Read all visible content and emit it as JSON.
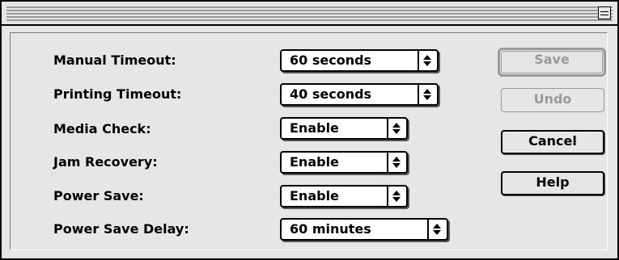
{
  "title_bar": {
    "collapse_icon": "window-collapse-icon"
  },
  "settings": [
    {
      "label": "Manual Timeout:",
      "value": "60 seconds"
    },
    {
      "label": "Printing Timeout:",
      "value": "40 seconds"
    },
    {
      "label": "Media Check:",
      "value": "Enable"
    },
    {
      "label": "Jam Recovery:",
      "value": "Enable"
    },
    {
      "label": "Power Save:",
      "value": "Enable"
    },
    {
      "label": "Power Save Delay:",
      "value": "60 minutes"
    }
  ],
  "buttons": {
    "save": "Save",
    "undo": "Undo",
    "cancel": "Cancel",
    "help": "Help"
  },
  "popup_arrow_icon": "up-down-arrows-icon"
}
